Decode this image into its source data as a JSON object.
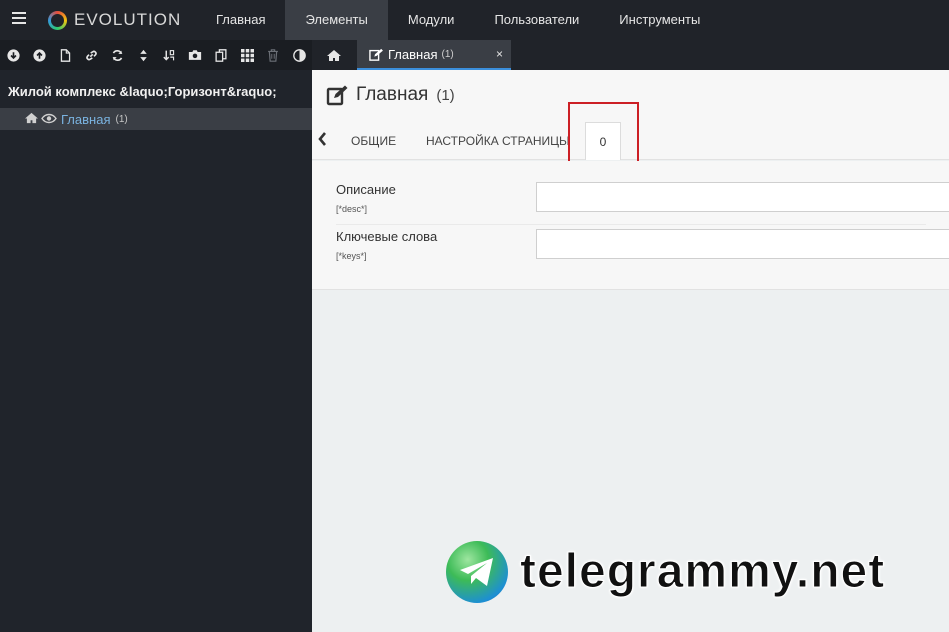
{
  "topbar": {
    "brand": "EVOLUTION",
    "menu": [
      "Главная",
      "Элементы",
      "Модули",
      "Пользователи",
      "Инструменты"
    ],
    "active_menu": "Элементы"
  },
  "sidebar": {
    "toolbar_icons": [
      "circle-arrow-down-icon",
      "circle-arrow-up-icon",
      "file-icon",
      "link-icon",
      "refresh-icon",
      "sort-icon",
      "sort-numeric-icon",
      "camera-icon",
      "copy-icon",
      "grid-icon",
      "trash-icon",
      "contrast-icon"
    ],
    "tree_root": "Жилой комплекс &laquo;Горизонт&raquo;",
    "tree_item_label": "Главная",
    "tree_item_count": "(1)"
  },
  "tabstrip": {
    "doc_tab_title": "Главная",
    "doc_tab_count": "(1)",
    "close_symbol": "×"
  },
  "page": {
    "title": "Главная",
    "count": "(1)",
    "tabs": [
      "Общие",
      "Настройка страницы"
    ],
    "active_tab": "0"
  },
  "fields": [
    {
      "label": "Описание",
      "tv": "[*desc*]",
      "value": ""
    },
    {
      "label": "Ключевые слова",
      "tv": "[*keys*]",
      "value": ""
    }
  ],
  "watermark": {
    "text": "telegrammy.net"
  },
  "colors": {
    "accent": "#3b8fdc",
    "highlight": "#cc1f25",
    "topbar": "#202329"
  }
}
